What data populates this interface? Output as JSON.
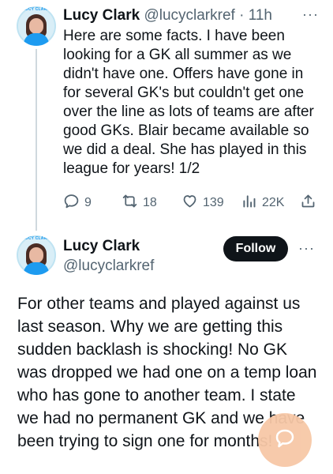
{
  "tweet1": {
    "author_name": "Lucy Clark",
    "handle": "@lucyclarkref",
    "separator": "·",
    "time": "11h",
    "more_label": "···",
    "avatar_banner": "LUCY CLARK",
    "text": "Here are some facts. I have been looking for a GK all summer as we didn't have one. Offers have gone in for several GK's but couldn't get one over the line as lots of teams are after good GKs. Blair became available so we did a deal. She has played in this league for years! 1/2",
    "stats": {
      "replies": "9",
      "retweets": "18",
      "likes": "139",
      "views": "22K"
    }
  },
  "tweet2": {
    "author_name": "Lucy Clark",
    "handle": "@lucyclarkref",
    "avatar_banner": "LUCY CLARK",
    "follow_label": "Follow",
    "more_label": "···",
    "text": "For other teams and played against us last season. Why we are getting this sudden backlash is shocking! No GK was dropped we had one on a temp loan who has gone to another team. I state we had no permanent GK and we have been trying to sign one for months!"
  },
  "icons": {
    "reply": "reply-icon",
    "retweet": "retweet-icon",
    "like": "heart-icon",
    "views": "views-icon",
    "share": "share-icon",
    "chat_fab": "chat-bubble-icon"
  },
  "colors": {
    "text": "#0f1419",
    "secondary": "#536471",
    "follow_bg": "#0f1419",
    "fab": "#f7c8a7",
    "thread_line": "#cfd9de"
  }
}
